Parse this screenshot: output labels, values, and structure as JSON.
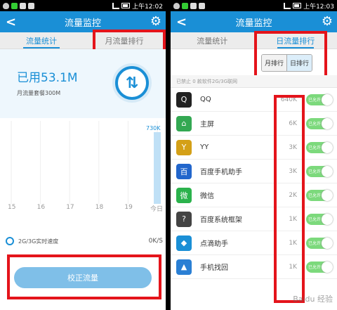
{
  "left": {
    "status": {
      "time": "上午12:02"
    },
    "title": "流量监控",
    "tabs": [
      {
        "label": "流量统计"
      },
      {
        "label": "月流量排行"
      }
    ],
    "used": "已用53.1M",
    "plan": "月流量套餐300M",
    "chart_data": {
      "type": "bar",
      "categories": [
        "15",
        "16",
        "17",
        "18",
        "19",
        "今日"
      ],
      "values": [
        0,
        0,
        0,
        0,
        0,
        730
      ],
      "bar_label": "730K",
      "value_unit": "K"
    },
    "speed": {
      "label": "2G/3G实时速度",
      "value": "0K/S"
    },
    "fix_button": "校正流量"
  },
  "right": {
    "status": {
      "time": "上午12:03"
    },
    "title": "流量监控",
    "tabs": [
      {
        "label": "流量统计"
      },
      {
        "label": "日流量排行"
      }
    ],
    "toggle": {
      "month": "月排行",
      "day": "日排行"
    },
    "header": "已禁止 0 款软件2G/3G联网",
    "apps": [
      {
        "name": "QQ",
        "value": "640K",
        "switch": "已允许",
        "color": "#222",
        "glyph": "Q"
      },
      {
        "name": "主屏",
        "value": "6K",
        "switch": "已允许",
        "color": "#33a852",
        "glyph": "⌂"
      },
      {
        "name": "YY",
        "value": "3K",
        "switch": "已允许",
        "color": "#d4a017",
        "glyph": "Y"
      },
      {
        "name": "百度手机助手",
        "value": "3K",
        "switch": "已允许",
        "color": "#2266cc",
        "glyph": "百"
      },
      {
        "name": "微信",
        "value": "2K",
        "switch": "已允许",
        "color": "#2bb24c",
        "glyph": "微"
      },
      {
        "name": "百度系统框架",
        "value": "1K",
        "switch": "已允许",
        "color": "#444",
        "glyph": "?"
      },
      {
        "name": "点滴助手",
        "value": "1K",
        "switch": "已允许",
        "color": "#1a8fd6",
        "glyph": "◆"
      },
      {
        "name": "手机找回",
        "value": "1K",
        "switch": "已允许",
        "color": "#2a7fd4",
        "glyph": "▲"
      }
    ]
  },
  "watermark": "Baidu 经验"
}
